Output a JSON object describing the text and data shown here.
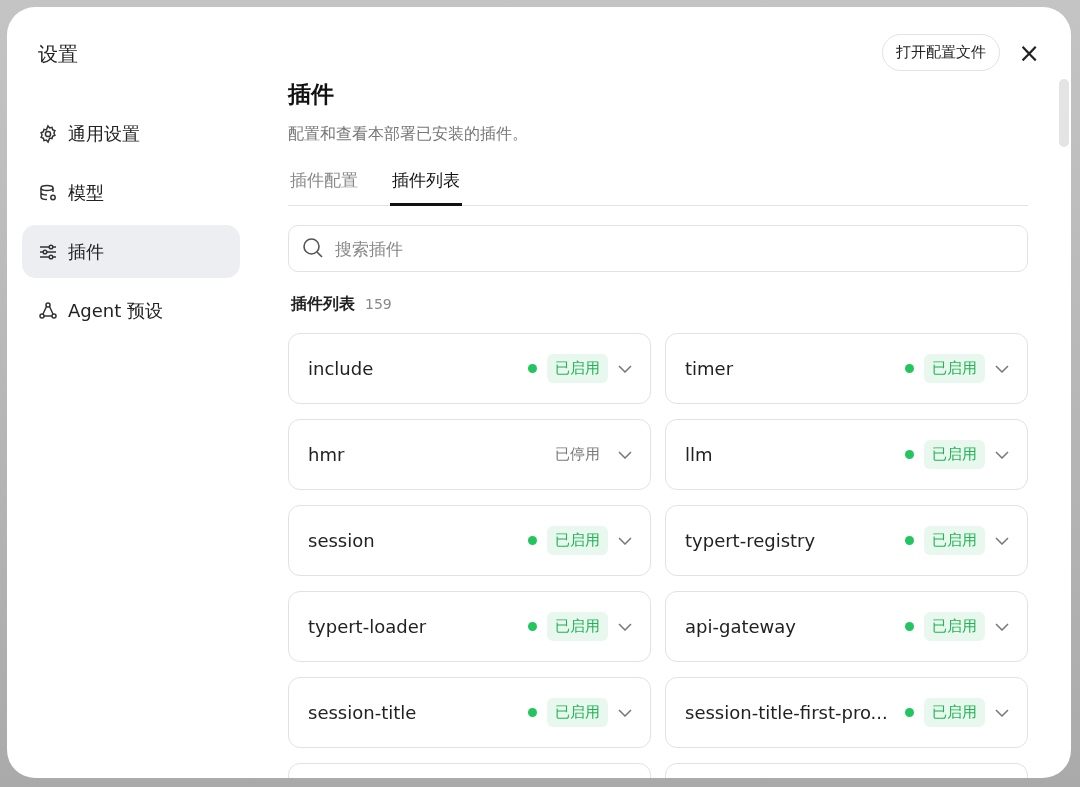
{
  "dialog": {
    "title": "设置",
    "open_config_button": "打开配置文件",
    "close_button": "×"
  },
  "sidebar": {
    "items": [
      {
        "label": "通用设置",
        "selected": false
      },
      {
        "label": "模型",
        "selected": false
      },
      {
        "label": "插件",
        "selected": true
      },
      {
        "label": "Agent 预设",
        "selected": false
      }
    ]
  },
  "page": {
    "title": "插件",
    "description": "配置和查看本部署已安装的插件。"
  },
  "tabs": [
    {
      "label": "插件配置",
      "selected": false
    },
    {
      "label": "插件列表",
      "selected": true
    }
  ],
  "search": {
    "placeholder": "搜索插件"
  },
  "list": {
    "title": "插件列表",
    "count": "159"
  },
  "plugins": [
    {
      "name": "include",
      "enabled": true,
      "status": "已启用"
    },
    {
      "name": "timer",
      "enabled": true,
      "status": "已启用"
    },
    {
      "name": "hmr",
      "enabled": false,
      "status": "已停用"
    },
    {
      "name": "llm",
      "enabled": true,
      "status": "已启用"
    },
    {
      "name": "session",
      "enabled": true,
      "status": "已启用"
    },
    {
      "name": "typert-registry",
      "enabled": true,
      "status": "已启用"
    },
    {
      "name": "typert-loader",
      "enabled": true,
      "status": "已启用"
    },
    {
      "name": "api-gateway",
      "enabled": true,
      "status": "已启用"
    },
    {
      "name": "session-title",
      "enabled": true,
      "status": "已启用"
    },
    {
      "name": "session-title-first-pro...",
      "enabled": true,
      "status": "已启用"
    }
  ]
}
